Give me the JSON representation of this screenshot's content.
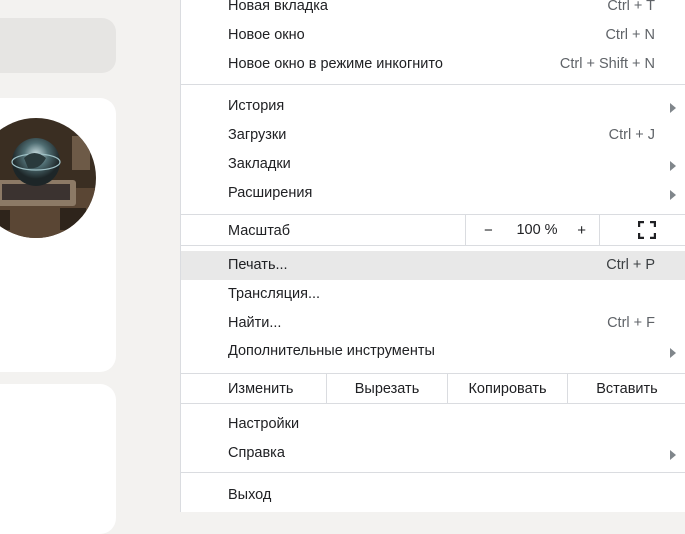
{
  "menu": {
    "new_tab": {
      "label": "Новая вкладка",
      "shortcut": "Ctrl + T"
    },
    "new_window": {
      "label": "Новое окно",
      "shortcut": "Ctrl + N"
    },
    "incognito": {
      "label": "Новое окно в режиме инкогнито",
      "shortcut": "Ctrl + Shift + N"
    },
    "history": {
      "label": "История"
    },
    "downloads": {
      "label": "Загрузки",
      "shortcut": "Ctrl + J"
    },
    "bookmarks": {
      "label": "Закладки"
    },
    "extensions": {
      "label": "Расширения"
    },
    "zoom": {
      "label": "Масштаб",
      "minus": "−",
      "value": "100 %",
      "plus": "+",
      "fullscreen_icon": "fullscreen-icon"
    },
    "print": {
      "label": "Печать...",
      "shortcut": "Ctrl + P"
    },
    "cast": {
      "label": "Трансляция..."
    },
    "find": {
      "label": "Найти...",
      "shortcut": "Ctrl + F"
    },
    "more_tools": {
      "label": "Дополнительные инструменты"
    },
    "edit": {
      "label": "Изменить",
      "cut": "Вырезать",
      "copy": "Копировать",
      "paste": "Вставить"
    },
    "settings": {
      "label": "Настройки"
    },
    "help": {
      "label": "Справка"
    },
    "exit": {
      "label": "Выход"
    }
  },
  "colors": {
    "menu_bg": "#ffffff",
    "hover_bg": "#e8e8e8",
    "separator": "#dadce0",
    "page_bg": "#f3f2f0"
  }
}
